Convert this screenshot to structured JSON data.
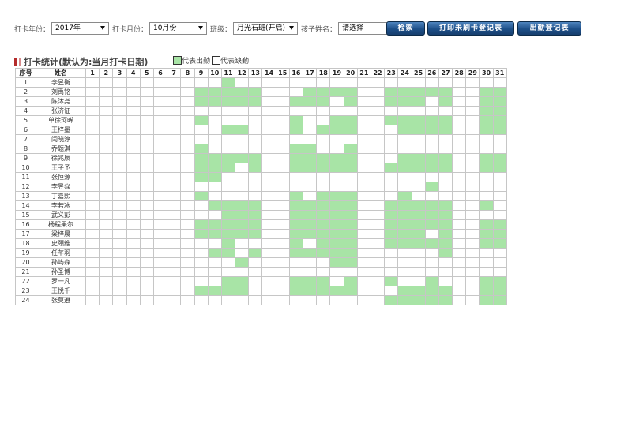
{
  "filters": {
    "year_label": "打卡年份：",
    "year_value": "2017年",
    "month_label": "打卡月份：",
    "month_value": "10月份",
    "class_label": "班级：",
    "class_value": "月光石班(开启)",
    "child_label": "孩子姓名：",
    "child_value": "请选择"
  },
  "buttons": {
    "search": "检索",
    "print": "打印未刷卡登记表",
    "attendance": "出勤登记表"
  },
  "title": "打卡统计(默认为:当月打卡日期)",
  "legend": {
    "present": "代表出勤",
    "absent": "代表缺勤"
  },
  "colors": {
    "present": "#a8e4a6",
    "button": "#1d4f88",
    "title_mark": "#b42b2b"
  },
  "table": {
    "col_index": "序号",
    "col_name": "姓名",
    "days": [
      "1",
      "2",
      "3",
      "4",
      "5",
      "6",
      "7",
      "8",
      "9",
      "10",
      "11",
      "12",
      "13",
      "14",
      "15",
      "16",
      "17",
      "18",
      "19",
      "20",
      "21",
      "22",
      "23",
      "24",
      "25",
      "26",
      "27",
      "28",
      "29",
      "30",
      "31"
    ],
    "rows": [
      {
        "no": "1",
        "name": "李昱衡",
        "present": [
          11
        ]
      },
      {
        "no": "2",
        "name": "刘禹铭",
        "present": [
          9,
          10,
          11,
          12,
          13,
          17,
          18,
          19,
          20,
          23,
          24,
          25,
          26,
          27,
          30,
          31
        ]
      },
      {
        "no": "3",
        "name": "陈沐尧",
        "present": [
          9,
          10,
          11,
          12,
          13,
          16,
          17,
          18,
          20,
          23,
          24,
          25,
          27,
          30,
          31
        ]
      },
      {
        "no": "4",
        "name": "张济证",
        "present": [
          30,
          31
        ]
      },
      {
        "no": "5",
        "name": "单徐珂晞",
        "present": [
          9,
          16,
          19,
          20,
          23,
          24,
          25,
          26,
          27,
          30,
          31
        ]
      },
      {
        "no": "6",
        "name": "王梓墨",
        "present": [
          11,
          12,
          16,
          18,
          19,
          20,
          24,
          25,
          26,
          27,
          30,
          31
        ]
      },
      {
        "no": "7",
        "name": "闫晓淳",
        "present": []
      },
      {
        "no": "8",
        "name": "乔题淇",
        "present": [
          9,
          16,
          17,
          20
        ]
      },
      {
        "no": "9",
        "name": "徐兆辰",
        "present": [
          9,
          10,
          11,
          12,
          13,
          16,
          17,
          18,
          19,
          20,
          24,
          25,
          26,
          27,
          30,
          31
        ]
      },
      {
        "no": "10",
        "name": "王子予",
        "present": [
          9,
          10,
          11,
          13,
          16,
          17,
          18,
          19,
          20,
          23,
          24,
          25,
          26,
          27,
          30,
          31
        ]
      },
      {
        "no": "11",
        "name": "张恒源",
        "present": [
          9,
          10
        ]
      },
      {
        "no": "12",
        "name": "李昱焱",
        "present": [
          26
        ]
      },
      {
        "no": "13",
        "name": "丁嘉熙",
        "present": [
          9,
          16,
          18,
          19,
          20,
          24
        ]
      },
      {
        "no": "14",
        "name": "李若冰",
        "present": [
          10,
          11,
          12,
          13,
          16,
          17,
          18,
          19,
          20,
          23,
          24,
          25,
          26,
          27,
          30
        ]
      },
      {
        "no": "15",
        "name": "武义彭",
        "present": [
          11,
          12,
          13,
          16,
          17,
          18,
          19,
          20,
          23,
          24,
          25,
          26,
          27
        ]
      },
      {
        "no": "16",
        "name": "杨程果尔",
        "present": [
          9,
          10,
          11,
          12,
          13,
          16,
          17,
          18,
          19,
          20,
          23,
          24,
          25,
          26,
          27,
          30,
          31
        ]
      },
      {
        "no": "17",
        "name": "梁梓晨",
        "present": [
          9,
          10,
          11,
          12,
          13,
          16,
          17,
          18,
          19,
          20,
          23,
          24,
          25,
          27,
          30,
          31
        ]
      },
      {
        "no": "18",
        "name": "史頤维",
        "present": [
          11,
          16,
          18,
          19,
          20,
          23,
          24,
          25,
          26,
          27,
          30,
          31
        ]
      },
      {
        "no": "19",
        "name": "任芊羽",
        "present": [
          10,
          11,
          13,
          16,
          17,
          18,
          19,
          20,
          27
        ]
      },
      {
        "no": "20",
        "name": "孙屿森",
        "present": [
          12,
          19,
          20
        ]
      },
      {
        "no": "21",
        "name": "孙圣博",
        "present": []
      },
      {
        "no": "22",
        "name": "罗一凡",
        "present": [
          11,
          12,
          16,
          17,
          18,
          20,
          23,
          26,
          30,
          31
        ]
      },
      {
        "no": "23",
        "name": "王悦千",
        "present": [
          9,
          10,
          11,
          12,
          16,
          17,
          18,
          19,
          20,
          24,
          25,
          26,
          27,
          30,
          31
        ]
      },
      {
        "no": "24",
        "name": "张莫逍",
        "present": [
          23,
          24,
          25,
          26,
          27,
          30,
          31
        ]
      }
    ]
  }
}
